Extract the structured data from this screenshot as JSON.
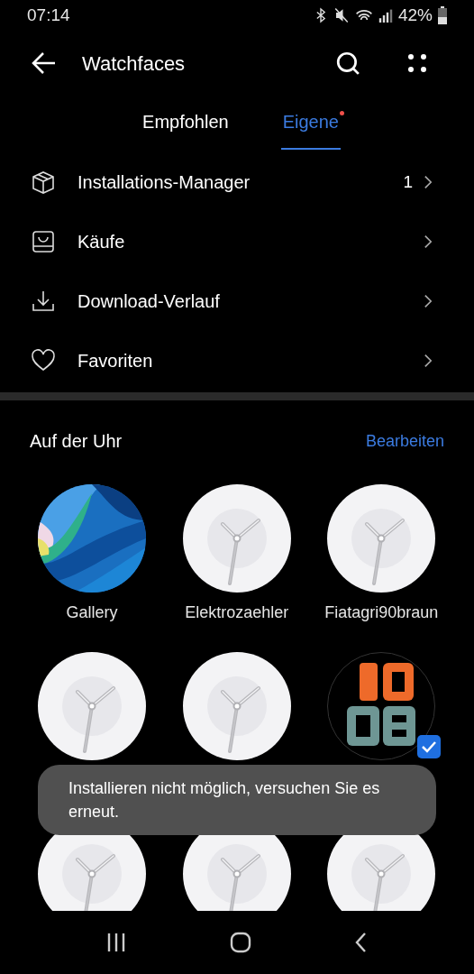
{
  "status_bar": {
    "time": "07:14",
    "battery": "42%"
  },
  "header": {
    "title": "Watchfaces"
  },
  "tabs": [
    {
      "label": "Empfohlen",
      "selected": false,
      "badge": false
    },
    {
      "label": "Eigene",
      "selected": true,
      "badge": true
    }
  ],
  "menu": [
    {
      "kind": "box",
      "label": "Installations-Manager",
      "count": "1"
    },
    {
      "kind": "bag",
      "label": "Käufe"
    },
    {
      "kind": "download",
      "label": "Download-Verlauf"
    },
    {
      "kind": "heart",
      "label": "Favoriten"
    }
  ],
  "section": {
    "title": "Auf der Uhr",
    "action": "Bearbeiten"
  },
  "watchfaces": [
    {
      "kind": "gallery",
      "name": "Gallery",
      "selected": false
    },
    {
      "kind": "analog",
      "name": "Elektrozaehler",
      "selected": false
    },
    {
      "kind": "analog",
      "name": "Fiatagri90braun",
      "selected": false
    },
    {
      "kind": "analog",
      "selected": false
    },
    {
      "kind": "analog",
      "selected": false
    },
    {
      "kind": "digits",
      "selected": true
    },
    {
      "kind": "analog",
      "selected": false
    },
    {
      "kind": "analog",
      "selected": false
    },
    {
      "kind": "analog",
      "selected": false
    }
  ],
  "toast": {
    "message": "Installieren nicht möglich, versuchen Sie es erneut."
  }
}
